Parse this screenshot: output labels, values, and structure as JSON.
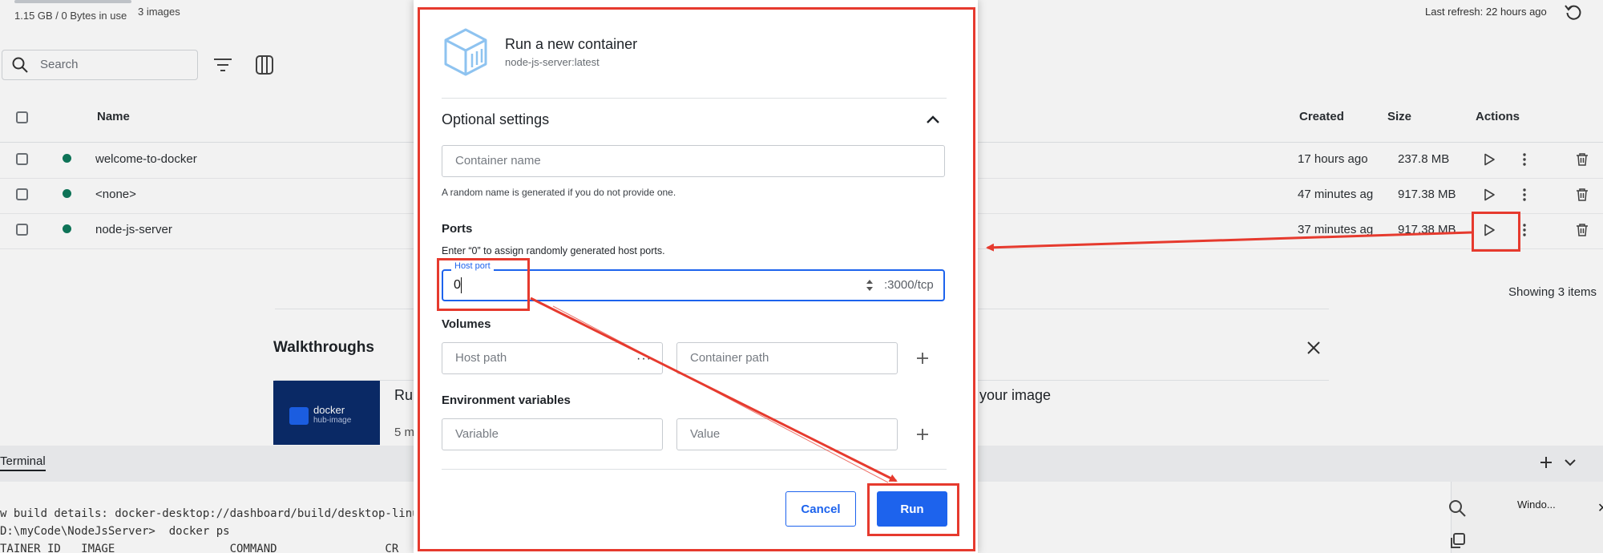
{
  "topbar": {
    "storage": "1.15 GB / 0 Bytes in use",
    "images_count": "3 images",
    "last_refresh": "Last refresh: 22 hours ago"
  },
  "toolbar": {
    "search_placeholder": "Search"
  },
  "table": {
    "headers": {
      "name": "Name",
      "created": "Created",
      "size": "Size",
      "actions": "Actions"
    },
    "rows": [
      {
        "name": "welcome-to-docker",
        "created": "17 hours ago",
        "size": "237.8 MB"
      },
      {
        "name": "<none>",
        "created": "47 minutes ag",
        "size": "917.38 MB"
      },
      {
        "name": "node-js-server",
        "created": "37 minutes ag",
        "size": "917.38 MB"
      }
    ],
    "showing": "Showing 3 items"
  },
  "walkthroughs": {
    "title": "Walkthroughs",
    "thumb_title": "docker",
    "thumb_sub": "hub-image",
    "item_left": "Ru",
    "item_right": "your image",
    "item_meta": "5 m"
  },
  "terminal": {
    "tab": "Terminal",
    "lines": [
      "w build details: docker-desktop://dashboard/build/desktop-linux/d",
      "D:\\myCode\\NodeJsServer>  docker ps",
      "TAINER ID   IMAGE                 COMMAND                CR"
    ],
    "side_label": "Windo..."
  },
  "modal": {
    "title": "Run a new container",
    "subtitle": "node-js-server:latest",
    "optional_settings": "Optional settings",
    "container_name_placeholder": "Container name",
    "container_name_help": "A random name is generated if you do not provide one.",
    "ports_label": "Ports",
    "ports_help": "Enter “0” to assign randomly generated host ports.",
    "host_port_legend": "Host port",
    "host_port_value": "0",
    "host_port_suffix": ":3000/tcp",
    "volumes_label": "Volumes",
    "host_path_placeholder": "Host path",
    "host_path_dots": "···",
    "container_path_placeholder": "Container path",
    "env_label": "Environment variables",
    "variable_placeholder": "Variable",
    "value_placeholder": "Value",
    "cancel_label": "Cancel",
    "run_label": "Run"
  },
  "colors": {
    "accent": "#1d63ed",
    "annotation": "#e63a2e",
    "status_green": "#0f7a5c"
  }
}
